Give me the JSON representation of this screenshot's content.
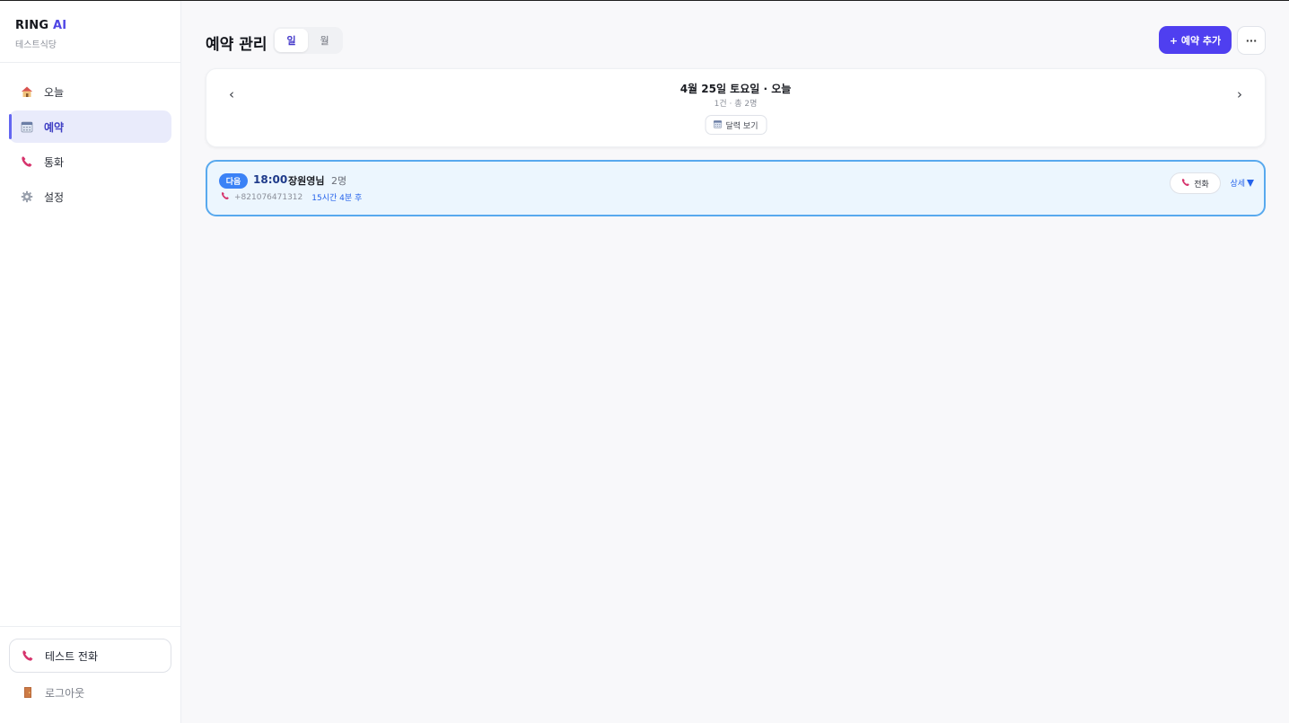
{
  "brand": {
    "name": "RING",
    "name_accent": "AI",
    "store": "테스트식당"
  },
  "nav": {
    "items": [
      {
        "label": "오늘",
        "icon": "house-icon"
      },
      {
        "label": "예약",
        "icon": "calendar-icon"
      },
      {
        "label": "통화",
        "icon": "phone-icon"
      },
      {
        "label": "설정",
        "icon": "gear-icon"
      }
    ]
  },
  "sidebar_bottom": {
    "test_call_label": "테스트 전화",
    "logout_label": "로그아웃"
  },
  "header": {
    "title": "예약 관리",
    "view_tabs": [
      {
        "label": "일"
      },
      {
        "label": "월"
      }
    ],
    "add_label": "+ 예약 추가",
    "more_label": "···"
  },
  "date_nav": {
    "prev": "‹",
    "next": "›",
    "title": "4월 25일 토요일 · 오늘",
    "summary": "1건 · 총 2명",
    "calendar_label": "달력 보기"
  },
  "reservations": [
    {
      "badge": "다음",
      "time": "18:00",
      "name": "장원영님",
      "party": "2명",
      "phone": "+821076471312",
      "until": "15시간 4분 후",
      "call_label": "전화",
      "detail_label": "상세"
    }
  ],
  "colors": {
    "accent": "#4f3ff0",
    "active_nav_bg": "#e9ebfb",
    "card_highlight_border": "#58a9ee",
    "badge": "#3b82f6"
  }
}
